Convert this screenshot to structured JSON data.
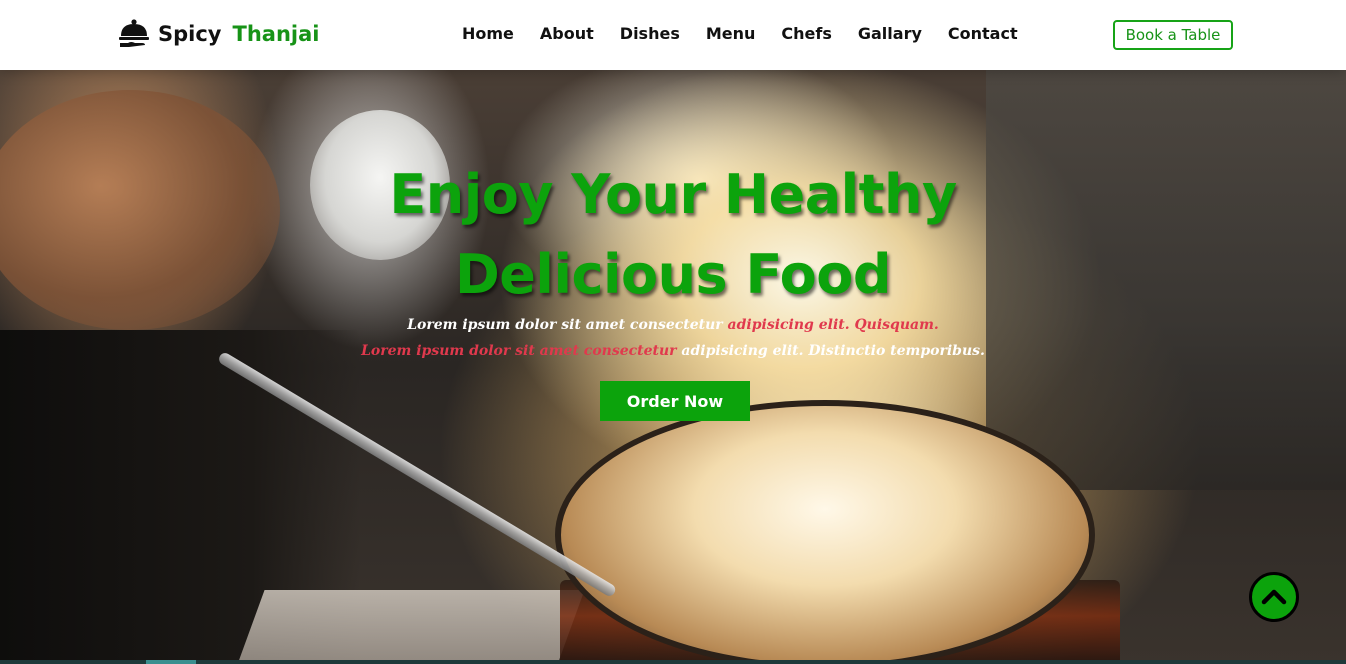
{
  "header": {
    "logo_part1": "Spicy",
    "logo_part2": "Thanjai",
    "logo_icon": "cloche-serving-icon",
    "nav": [
      "Home",
      "About",
      "Dishes",
      "Menu",
      "Chefs",
      "Gallary",
      "Contact"
    ],
    "book_label": "Book a Table"
  },
  "hero": {
    "title_line1": "Enjoy Your Healthy",
    "title_line2": "Delicious Food",
    "text_line1": [
      {
        "text": "Lorem ipsum dolor sit amet consectetur",
        "color": "white"
      },
      {
        "text": " adipisicing elit. Quisquam.",
        "color": "red"
      }
    ],
    "text_line2": [
      {
        "text": "Lorem ipsum dolor sit amet consectetur",
        "color": "red"
      },
      {
        "text": " adipisicing elit. Distinctio temporibus.",
        "color": "white"
      }
    ],
    "order_label": "Order Now",
    "scroll_top_icon": "chevron-up-icon"
  },
  "colors": {
    "brand_green": "#0ca30c",
    "accent_red": "#e0394d",
    "header_bg": "#ffffff"
  }
}
